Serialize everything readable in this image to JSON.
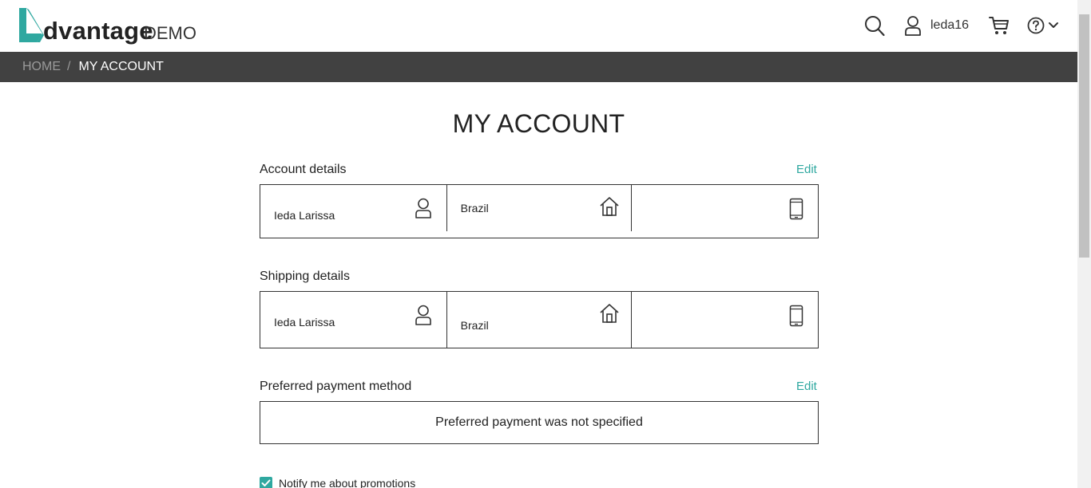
{
  "brand": {
    "name": "dvantage",
    "suffix": "DEMO",
    "accent": "#2fa8a0"
  },
  "header": {
    "username": "leda16"
  },
  "breadcrumb": {
    "home": "HOME",
    "separator": "/",
    "current": "MY ACCOUNT"
  },
  "page": {
    "title": "MY ACCOUNT"
  },
  "account_details": {
    "title": "Account details",
    "edit": "Edit",
    "name": "Ieda Larissa",
    "country": "Brazil",
    "phone": ""
  },
  "shipping_details": {
    "title": "Shipping details",
    "name": "Ieda Larissa",
    "country": "Brazil",
    "phone": ""
  },
  "payment": {
    "title": "Preferred payment method",
    "edit": "Edit",
    "message": "Preferred payment was not specified"
  },
  "promotions": {
    "label": "Notify me about promotions",
    "checked": true
  },
  "icons": [
    "search-icon",
    "user-icon",
    "cart-icon",
    "help-icon",
    "chevron-down-icon",
    "person-icon",
    "home-icon",
    "phone-icon",
    "checkmark-icon"
  ]
}
